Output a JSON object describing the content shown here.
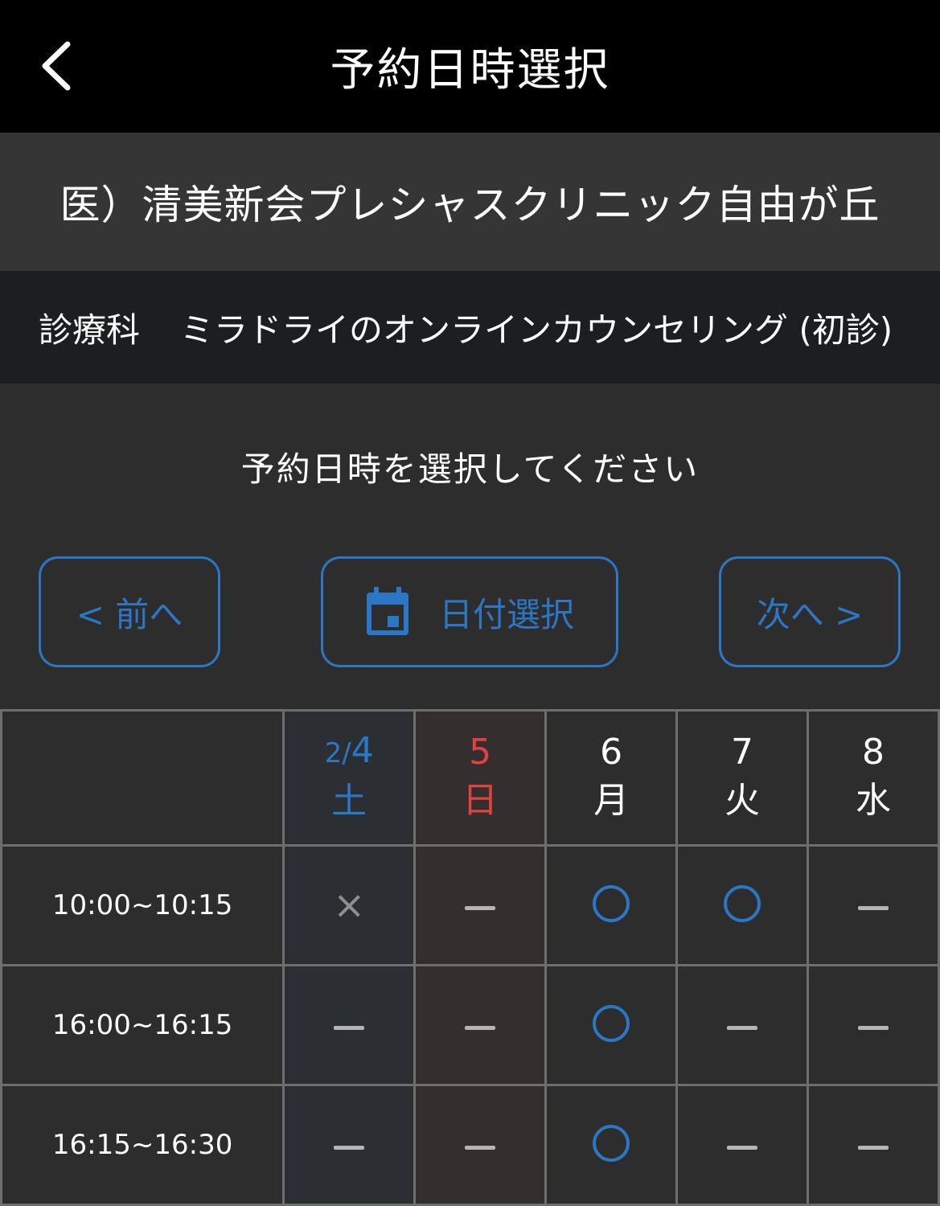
{
  "header": {
    "title": "予約日時選択",
    "back_icon": "chevron-left-icon"
  },
  "clinic": {
    "name": "医）清美新会プレシャスクリニック自由が丘"
  },
  "department": {
    "label": "診療科",
    "value": "ミラドライのオンラインカウンセリング (初診)"
  },
  "instruction": "予約日時を選択してください",
  "nav": {
    "prev_label": "< 前へ",
    "date_label": "日付選択",
    "next_label": "次へ >",
    "calendar_icon": "calendar-icon"
  },
  "days": [
    {
      "month": "2/",
      "day": "4",
      "weekday": "土",
      "type": "sat"
    },
    {
      "month": "",
      "day": "5",
      "weekday": "日",
      "type": "sun"
    },
    {
      "month": "",
      "day": "6",
      "weekday": "月",
      "type": "weekday"
    },
    {
      "month": "",
      "day": "7",
      "weekday": "火",
      "type": "weekday"
    },
    {
      "month": "",
      "day": "8",
      "weekday": "水",
      "type": "weekday"
    }
  ],
  "slots": [
    {
      "time": "10:00~10:15",
      "status": [
        "cross",
        "dash",
        "circle",
        "circle",
        "dash"
      ]
    },
    {
      "time": "16:00~16:15",
      "status": [
        "dash",
        "dash",
        "circle",
        "dash",
        "dash"
      ]
    },
    {
      "time": "16:15~16:30",
      "status": [
        "dash",
        "dash",
        "circle",
        "dash",
        "dash"
      ]
    }
  ],
  "status_glyphs": {
    "cross": "×",
    "dash": "—",
    "circle": "○"
  },
  "colors": {
    "accent": "#2b77c6",
    "sunday": "#e0433e",
    "header_bg": "#000000",
    "page_bg": "#2d2d2d"
  }
}
